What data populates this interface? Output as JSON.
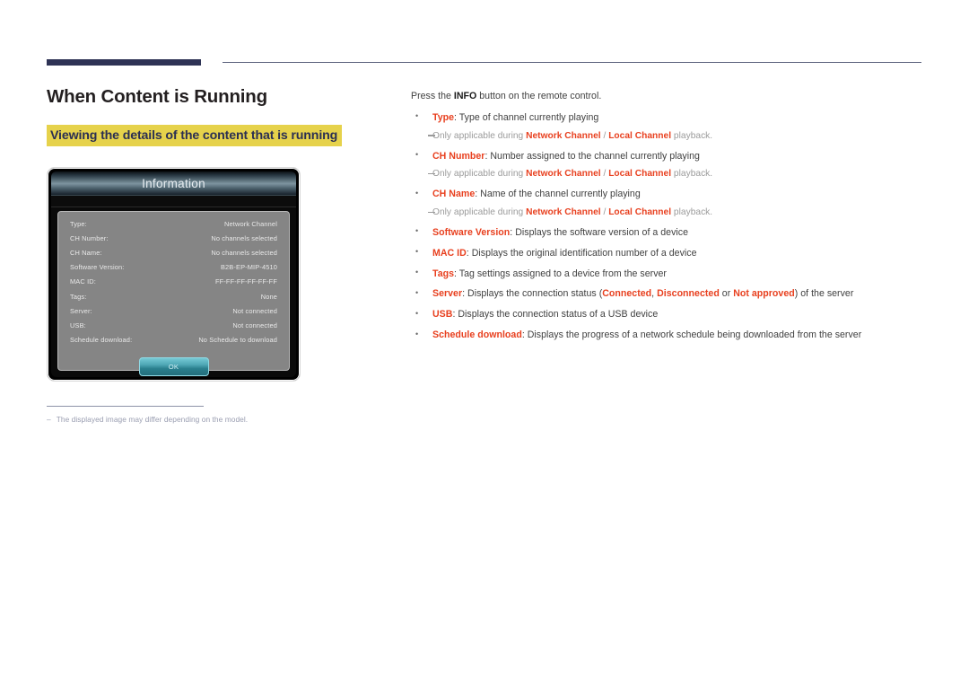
{
  "header": {
    "title": "When Content is Running",
    "subheading": "Viewing the details of the content that is running"
  },
  "dialog": {
    "title": "Information",
    "rows": [
      {
        "label": "Type:",
        "value": "Network Channel"
      },
      {
        "label": "CH Number:",
        "value": "No channels selected"
      },
      {
        "label": "CH Name:",
        "value": "No channels selected"
      },
      {
        "label": "Software Version:",
        "value": "B2B-EP-MIP-4510"
      },
      {
        "label": "MAC ID:",
        "value": "FF-FF-FF-FF-FF-FF"
      },
      {
        "label": "Tags:",
        "value": "None"
      },
      {
        "label": "Server:",
        "value": "Not connected"
      },
      {
        "label": "USB:",
        "value": "Not connected"
      },
      {
        "label": "Schedule download:",
        "value": "No Schedule to download"
      }
    ],
    "ok_label": "OK"
  },
  "footnote": {
    "dash": "–",
    "text": "The displayed image may differ depending on the model."
  },
  "content": {
    "intro_before": "Press the ",
    "intro_bold": "INFO",
    "intro_after": " button on the remote control.",
    "bullets": [
      {
        "term": "Type",
        "desc": ": Type of channel currently playing",
        "note": {
          "prefix": "Only applicable during ",
          "first": "Network Channel",
          "sep": " / ",
          "second": "Local Channel",
          "suffix": " playback."
        }
      },
      {
        "term": "CH Number",
        "desc": ": Number assigned to the channel currently playing",
        "note": {
          "prefix": "Only applicable during ",
          "first": "Network Channel",
          "sep": " / ",
          "second": "Local Channel",
          "suffix": " playback."
        }
      },
      {
        "term": "CH Name",
        "desc": ": Name of the channel currently playing",
        "note": {
          "prefix": "Only applicable during ",
          "first": "Network Channel",
          "sep": " / ",
          "second": "Local Channel",
          "suffix": " playback."
        }
      },
      {
        "term": "Software Version",
        "desc": ": Displays the software version of a device"
      },
      {
        "term": "MAC ID",
        "desc": ": Displays the original identification number of a device"
      },
      {
        "term": "Tags",
        "desc": ": Tag settings assigned to a device from the server"
      },
      {
        "term": "Server",
        "desc_a": ": Displays the connection status (",
        "status1": "Connected",
        "desc_b": ", ",
        "status2": "Disconnected",
        "desc_c": " or ",
        "status3": "Not approved",
        "desc_d": ") of the server"
      },
      {
        "term": "USB",
        "desc": ": Displays the connection status of a USB device"
      },
      {
        "term": "Schedule download",
        "desc": ": Displays the progress of a network schedule being downloaded from the server"
      }
    ]
  },
  "colors": {
    "accent_red": "#e8401f",
    "navy": "#2e3355",
    "highlight_yellow": "#e6d24b"
  }
}
